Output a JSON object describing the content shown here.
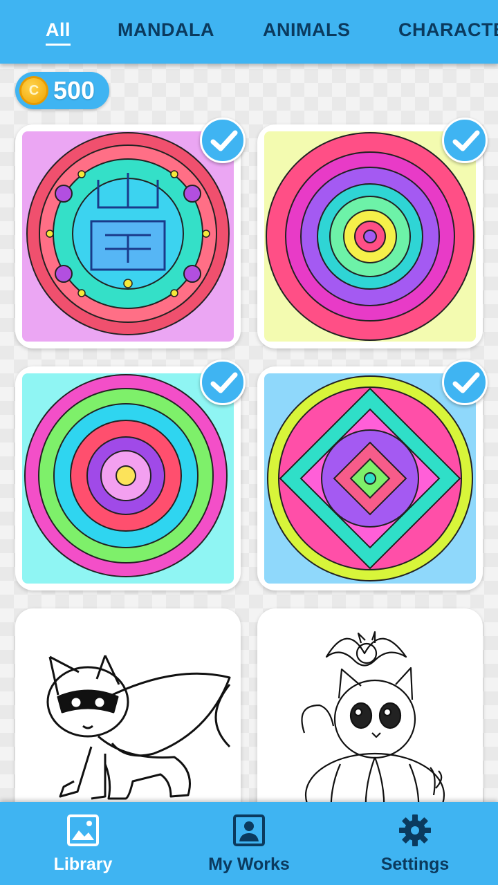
{
  "tabs": [
    {
      "label": "All",
      "active": true
    },
    {
      "label": "MANDALA",
      "active": false
    },
    {
      "label": "ANIMALS",
      "active": false
    },
    {
      "label": "CHARACTE",
      "active": false
    }
  ],
  "coins": {
    "icon_letter": "C",
    "count": "500"
  },
  "grid": {
    "items": [
      {
        "name": "mandala-pink-red",
        "completed": true
      },
      {
        "name": "mandala-petal-flower",
        "completed": true
      },
      {
        "name": "mandala-leaf-ring",
        "completed": true
      },
      {
        "name": "mandala-stained-glass",
        "completed": true
      },
      {
        "name": "raccoon-cat-hero",
        "completed": false
      },
      {
        "name": "kitten-pumpkin-bat",
        "completed": false
      }
    ]
  },
  "nav": {
    "items": [
      {
        "label": "Library",
        "icon": "image-icon",
        "active": true
      },
      {
        "label": "My Works",
        "icon": "portrait-icon",
        "active": false
      },
      {
        "label": "Settings",
        "icon": "gear-icon",
        "active": false
      }
    ]
  },
  "colors": {
    "accent": "#3fb4f2",
    "text_dark": "#0b3a5e"
  }
}
